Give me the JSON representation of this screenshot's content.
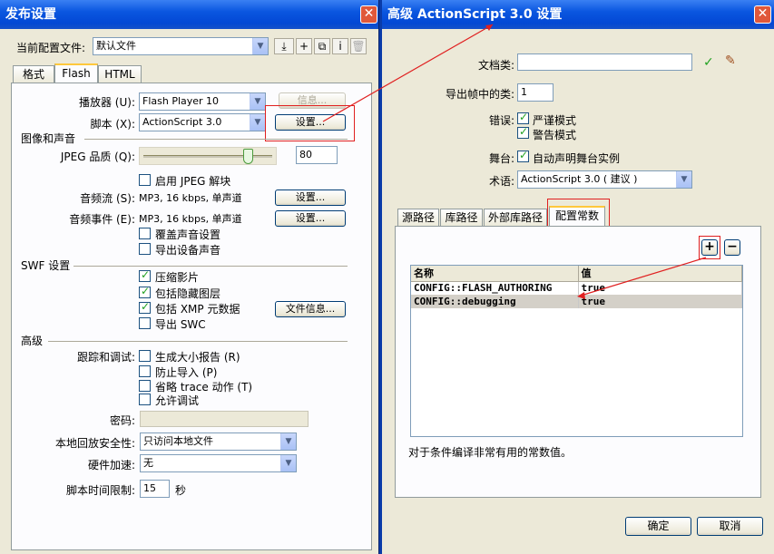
{
  "left": {
    "title": "发布设置",
    "profile_label": "当前配置文件:",
    "profile_value": "默认文件",
    "tabs": [
      "格式",
      "Flash",
      "HTML"
    ],
    "player_label": "播放器 (U):",
    "player_value": "Flash Player 10",
    "info_button": "信息...",
    "script_label": "脚本 (X):",
    "script_value": "ActionScript 3.0",
    "settings_button": "设置...",
    "image_sound_header": "图像和声音",
    "jpeg_label": "JPEG 品质 (Q):",
    "jpeg_value": "80",
    "jpeg_quality_level": 0.8,
    "enable_jpeg_deblock": "启用 JPEG 解块",
    "audio_stream_label": "音频流 (S):",
    "audio_stream_value": "MP3, 16 kbps, 单声道",
    "audio_event_label": "音频事件 (E):",
    "audio_event_value": "MP3, 16 kbps, 单声道",
    "set_button": "设置...",
    "override_sound": "覆盖声音设置",
    "export_device_sound": "导出设备声音",
    "swf_header": "SWF 设置",
    "compress_movie": "压缩影片",
    "include_hidden_layers": "包括隐藏图层",
    "include_xmp": "包括 XMP 元数据",
    "file_info_button": "文件信息...",
    "export_swc": "导出 SWC",
    "advanced_header": "高级",
    "trace_debug_label": "跟踪和调试:",
    "size_report": "生成大小报告 (R)",
    "protect_import": "防止导入 (P)",
    "omit_trace": "省略 trace 动作 (T)",
    "permit_debug": "允许调试",
    "password_label": "密码:",
    "local_security_label": "本地回放安全性:",
    "local_security_value": "只访问本地文件",
    "hw_accel_label": "硬件加速:",
    "hw_accel_value": "无",
    "script_time_label": "脚本时间限制:",
    "script_time_value": "15",
    "seconds_unit": "秒"
  },
  "right": {
    "title": "高级 ActionScript 3.0 设置",
    "doc_class_label": "文档类:",
    "export_frame_label": "导出帧中的类:",
    "export_frame_value": "1",
    "errors_label": "错误:",
    "strict_mode": "严谨模式",
    "warnings_mode": "警告模式",
    "stage_label": "舞台:",
    "auto_declare": "自动声明舞台实例",
    "dialect_label": "术语:",
    "dialect_value": "ActionScript 3.0 ( 建议 )",
    "tabs": [
      "源路径",
      "库路径",
      "外部库路径",
      "配置常数"
    ],
    "table_headers": [
      "名称",
      "值"
    ],
    "rows": [
      {
        "name": "CONFIG::FLASH_AUTHORING",
        "value": "true"
      },
      {
        "name": "CONFIG::debugging",
        "value": "true"
      }
    ],
    "description": "对于条件编译非常有用的常数值。",
    "ok_button": "确定",
    "cancel_button": "取消"
  }
}
